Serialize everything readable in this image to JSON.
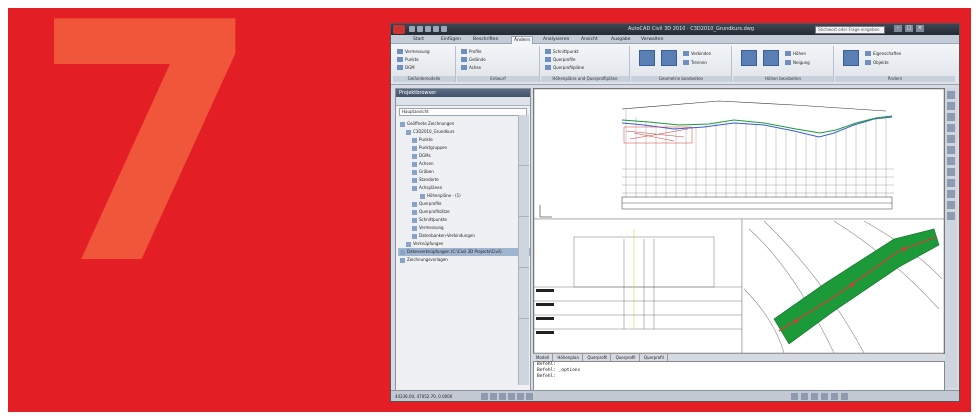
{
  "poster": {
    "chapter_number": "7",
    "background_color": "#e31e24",
    "numeral_color": "#f0573a"
  },
  "app": {
    "title": "AutoCAD Civil 3D 2010 · C3D2010_Grundkurs.dwg",
    "search_placeholder": "Stichwort oder Frage eingeben",
    "window_controls": [
      "–",
      "□",
      "×"
    ],
    "tabs": [
      "Start",
      "Einfügen",
      "Beschriften",
      "Ändern",
      "Analysieren",
      "Ansicht",
      "Ausgabe",
      "Verwalten"
    ],
    "active_tab": "Ändern",
    "ribbon_groups": [
      {
        "label": "Geländemodelle",
        "buttons": [
          "Vermessung",
          "Punkte",
          "DGM"
        ]
      },
      {
        "label": "Entwurf",
        "buttons": [
          "Profile",
          "Gelände",
          "Achse"
        ]
      },
      {
        "label": "Höhenpläne und Querprofilpläne",
        "buttons": [
          "Schnittpunkt",
          "Querprofile",
          "Querprofilpläne"
        ]
      },
      {
        "label": "Geometrie bearbeiten",
        "buttons": [
          "Verbinden",
          "Trennen"
        ]
      },
      {
        "label": "Höhen bearbeiten",
        "buttons": [
          "Höhen",
          "Neigung"
        ]
      },
      {
        "label": "Ändern",
        "buttons": [
          "Eigenschaften",
          "Objekte"
        ]
      }
    ]
  },
  "toolspace": {
    "title": "Projektbrowser",
    "combo_value": "Hauptansicht",
    "tree": [
      {
        "label": "Geöffnete Zeichnungen",
        "level": 0
      },
      {
        "label": "C3D2010_Grundkurs",
        "level": 1
      },
      {
        "label": "Punkte",
        "level": 2
      },
      {
        "label": "Punktgruppen",
        "level": 2
      },
      {
        "label": "DGMs",
        "level": 2
      },
      {
        "label": "Achsen",
        "level": 2
      },
      {
        "label": "Gräben",
        "level": 2
      },
      {
        "label": "Standorte",
        "level": 2
      },
      {
        "label": "Achsplänen",
        "level": 2
      },
      {
        "label": "Höhenpläne - (1)",
        "level": 3
      },
      {
        "label": "Querprofile",
        "level": 2
      },
      {
        "label": "Querprofilsätze",
        "level": 2
      },
      {
        "label": "Schnittpunkte",
        "level": 2
      },
      {
        "label": "Vermessung",
        "level": 2
      },
      {
        "label": "Datenbanken-Verbindungen",
        "level": 2
      },
      {
        "label": "Verknüpfungen",
        "level": 1
      },
      {
        "label": "Datenverknüpfungen (C:\\Civil 3D Projects\\Civil)",
        "level": 0,
        "selected": true
      },
      {
        "label": "Zeichnungsvorlagen",
        "level": 0
      }
    ]
  },
  "model_tabs": [
    "Modell",
    "Höhenplan",
    "Querprofil",
    "Querprofil",
    "Querprofil"
  ],
  "command_lines": [
    "Befehl:",
    "Befehl: _options",
    "Befehl:"
  ],
  "status": {
    "coordinates": "44236.04, 47052.70, 0.0000"
  },
  "colors": {
    "title_bar": "#2f3642",
    "surface_green": "#1c9a3a",
    "profile_blue": "#3b5bd6",
    "profile_red": "#d63a3a"
  }
}
